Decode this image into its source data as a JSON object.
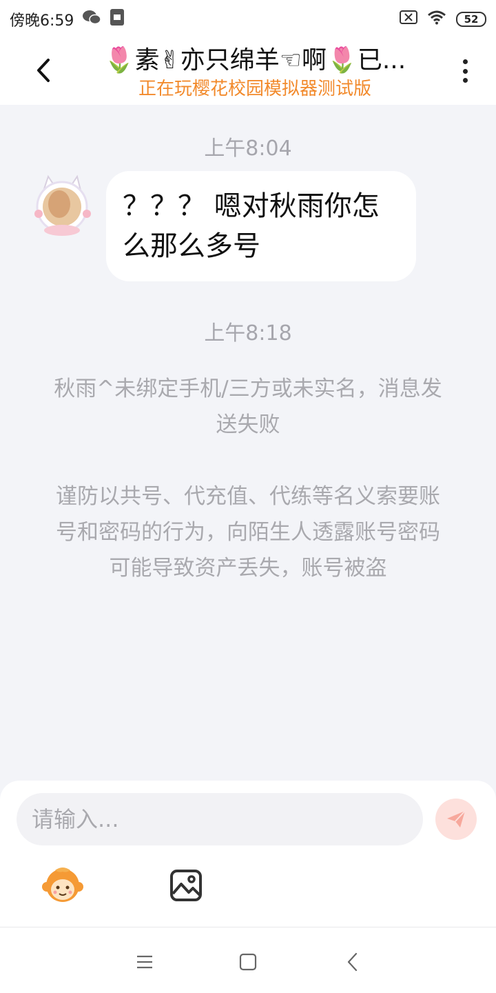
{
  "status_bar": {
    "time": "傍晚6:59",
    "battery": "52",
    "icons": [
      "wechat-icon",
      "app-notification-icon",
      "sim-off-icon",
      "wifi-icon",
      "battery-icon"
    ]
  },
  "header": {
    "title": "🌷素✌亦只绵羊☜啊🌷已...",
    "subtitle": "正在玩樱花校园模拟器测试版",
    "subtitle_color": "#f28a2c"
  },
  "chat": {
    "timestamp_1": "上午8:04",
    "message_1": "？？？ 嗯对秋雨你怎么那么多号",
    "timestamp_2": "上午8:18",
    "system_1": "秋雨^未绑定手机/三方或未实名，消息发送失败",
    "system_2": "谨防以共号、代充值、代练等名义索要账号和密码的行为，向陌生人透露账号密码可能导致资产丢失，账号被盗"
  },
  "input": {
    "placeholder": "请输入...",
    "send_color": "#fde0dc"
  },
  "colors": {
    "background": "#f3f4f8",
    "bubble": "#ffffff",
    "system_text": "#a9a9ae"
  }
}
